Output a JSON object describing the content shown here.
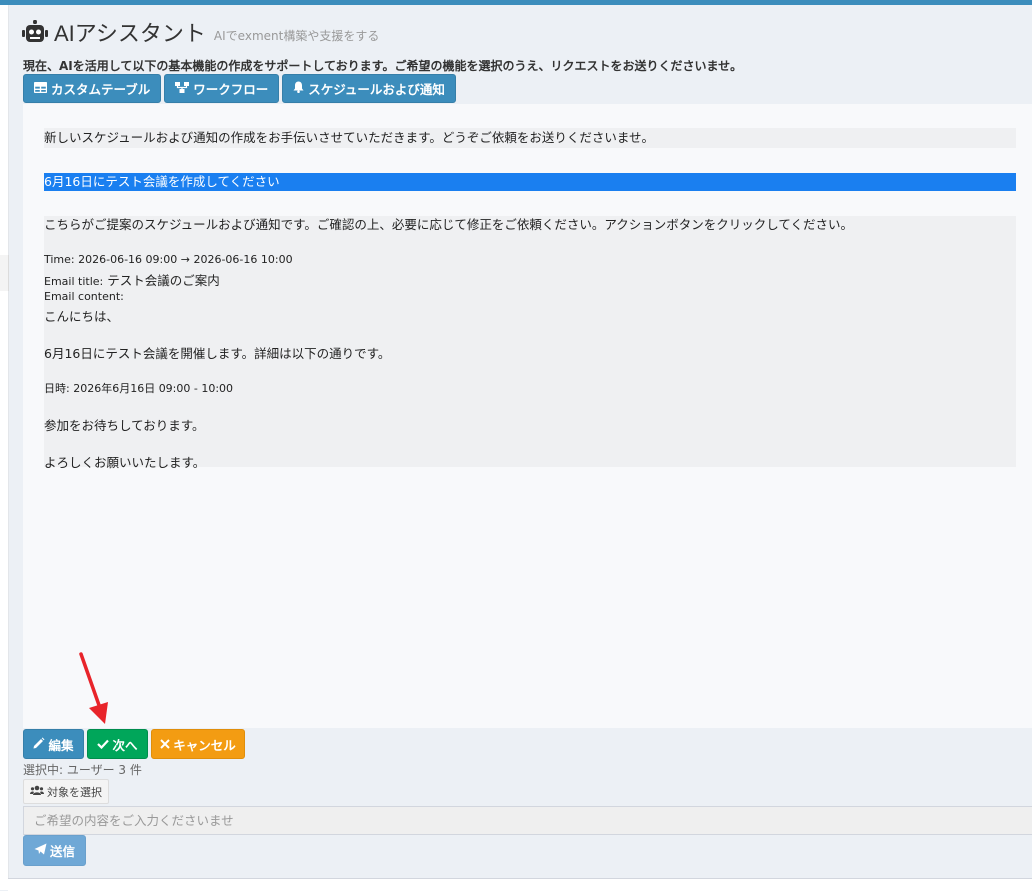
{
  "header": {
    "title": "AIアシスタント",
    "subtitle": "AIでexment構築や支援をする",
    "icon": "robot-icon"
  },
  "description": "現在、AIを活用して以下の基本機能の作成をサポートしております。ご希望の機能を選択のうえ、リクエストをお送りくださいませ。",
  "tabs": [
    {
      "label": "カスタムテーブル",
      "icon": "table-icon"
    },
    {
      "label": "ワークフロー",
      "icon": "sitemap-icon"
    },
    {
      "label": "スケジュールおよび通知",
      "icon": "bell-icon"
    }
  ],
  "chat": {
    "bot_intro": "新しいスケジュールおよび通知の作成をお手伝いさせていただきます。どうぞご依頼をお送りくださいませ。",
    "user_message": "6月16日にテスト会議を作成してください",
    "proposal": {
      "intro": "こちらがご提案のスケジュールおよび通知です。ご確認の上、必要に応じて修正をご依頼ください。アクションボタンをクリックしてください。",
      "time": "Time: 2026-06-16 09:00 → 2026-06-16 10:00",
      "email_title_label": "Email title:",
      "email_title": "テスト会議のご案内",
      "email_content_label": "Email content:",
      "content_lines": [
        "こんにちは、",
        "6月16日にテスト会議を開催します。詳細は以下の通りです。",
        "日時: 2026年6月16日 09:00 - 10:00",
        "参加をお待ちしております。",
        "よろしくお願いいたします。"
      ]
    }
  },
  "actions": {
    "edit": "編集",
    "next": "次へ",
    "cancel": "キャンセル"
  },
  "selection": {
    "info": "選択中: ユーザー 3 件",
    "select_button": "対象を選択"
  },
  "input": {
    "placeholder": "ご希望の内容をご入力くださいませ",
    "value": ""
  },
  "send_button": "送信",
  "colors": {
    "primary": "#3c8dbc",
    "success": "#00a65a",
    "warning": "#f39c12",
    "user_bubble": "#1a7ff0",
    "annotation_arrow": "#e8242a"
  }
}
